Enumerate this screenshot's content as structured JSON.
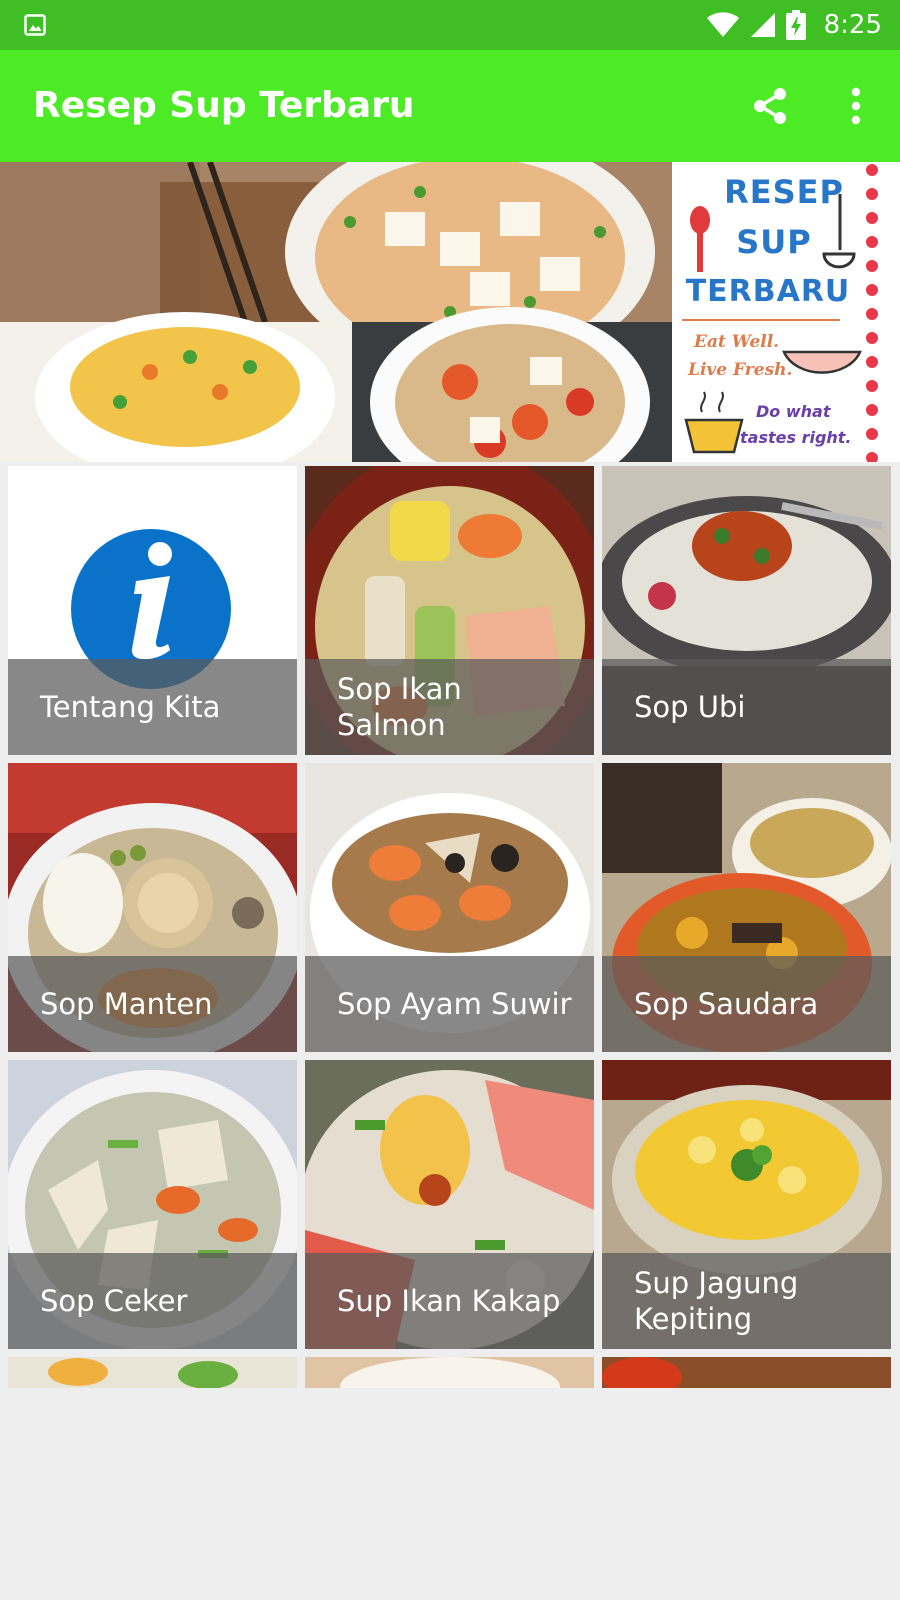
{
  "status_bar": {
    "time": "8:25",
    "left_icon": "image-notification-icon",
    "wifi_icon": "wifi-icon",
    "signal_icon": "cell-signal-icon",
    "battery_icon": "battery-charging-icon"
  },
  "app_bar": {
    "title": "Resep Sup Terbaru",
    "share_icon": "share-icon",
    "overflow_icon": "more-vert-icon"
  },
  "banner": {
    "title_lines": [
      "RESEP",
      "SUP",
      "TERBARU"
    ],
    "script_lines": [
      "Eat Well.",
      "Live Fresh."
    ],
    "tagline_lines": [
      "Do what",
      "tastes right."
    ]
  },
  "grid": {
    "items": [
      {
        "label": "Tentang Kita"
      },
      {
        "label": "Sop Ikan Salmon"
      },
      {
        "label": "Sop Ubi"
      },
      {
        "label": "Sop Manten"
      },
      {
        "label": "Sop Ayam Suwir"
      },
      {
        "label": "Sop Saudara"
      },
      {
        "label": "Sop Ceker"
      },
      {
        "label": "Sup Ikan Kakap"
      },
      {
        "label": "Sup Jagung Kepiting"
      }
    ]
  },
  "colors": {
    "status_bar": "#3fbf23",
    "app_bar": "#4ceb26",
    "info_icon": "#0a73c9",
    "caption_overlay": "#5a5a5a",
    "background": "#eeeeee"
  }
}
